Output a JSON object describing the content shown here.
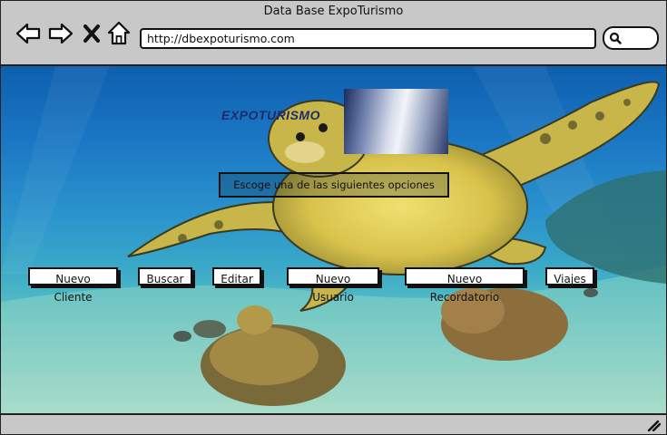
{
  "window": {
    "title": "Data Base ExpoTurismo"
  },
  "toolbar": {
    "back_icon": "back-arrow-icon",
    "forward_icon": "forward-arrow-icon",
    "stop_icon": "close-icon",
    "home_icon": "home-icon",
    "url": "http://dbexpoturismo.com",
    "search_icon": "search-icon"
  },
  "main": {
    "logo_text": "EXPOTURISMO",
    "prompt": "Escoge una de las siguientes opciones",
    "buttons": [
      {
        "label": "Nuevo Cliente"
      },
      {
        "label": "Buscar"
      },
      {
        "label": "Editar"
      },
      {
        "label": "Nuevo Usuario"
      },
      {
        "label": "Nuevo Recordatorio"
      },
      {
        "label": "Viajes"
      }
    ]
  },
  "colors": {
    "toolbar_bg": "#c8c8c8",
    "ocean_top": "#0e5fae",
    "ocean_bottom": "#9ad8c8",
    "logo_blue": "#1c2c6a"
  }
}
